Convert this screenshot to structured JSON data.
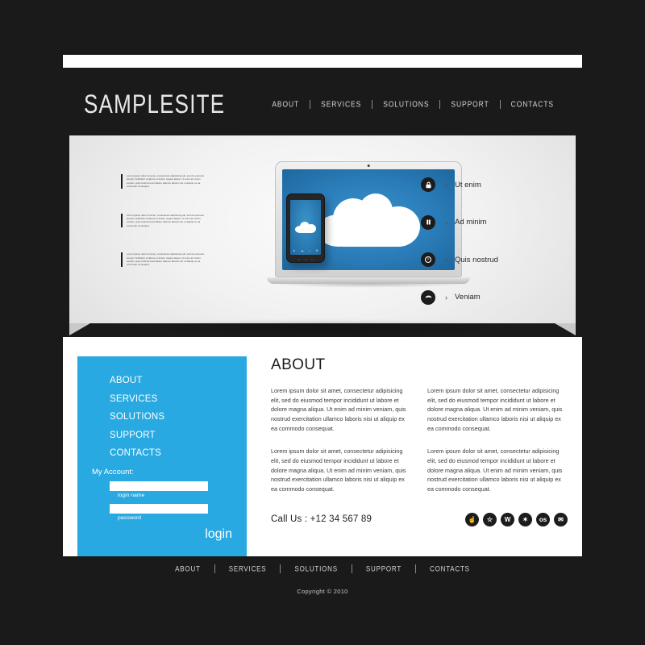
{
  "site": {
    "logo": "SAMPLESITE"
  },
  "topnav": {
    "items": [
      {
        "label": "ABOUT"
      },
      {
        "label": "SERVICES"
      },
      {
        "label": "SOLUTIONS"
      },
      {
        "label": "SUPPORT"
      },
      {
        "label": "CONTACTS"
      }
    ]
  },
  "hero": {
    "blurbs": [
      {
        "text": "Lorem ipsum dolor sit amet, consectetur adipisicing elit, sed do eiusmod tempor incididunt ut labore et dolore magna aliqua. Ut enim ad minim veniam, quis nostrud exercitation ullamco laboris nisi ut aliquip ex ea commodo consequat."
      },
      {
        "text": "Lorem ipsum dolor sit amet, consectetur adipisicing elit, sed do eiusmod tempor incididunt ut labore et dolore magna aliqua. Ut enim ad minim veniam, quis nostrud exercitation ullamco laboris nisi ut aliquip ex ea commodo consequat."
      },
      {
        "text": "Lorem ipsum dolor sit amet, consectetur adipisicing elit, sed do eiusmod tempor incididunt ut labore et dolore magna aliqua. Ut enim ad minim veniam, quis nostrud exercitation ullamco laboris nisi ut aliquip ex ea commodo consequat."
      }
    ],
    "features": [
      {
        "label": "Ut enim",
        "icon": "lock-icon",
        "glyph": " ",
        "arrow": "›"
      },
      {
        "label": "Ad minim",
        "icon": "book-icon",
        "glyph": " ",
        "arrow": "›"
      },
      {
        "label": "Quis nostrud",
        "icon": "clock-icon",
        "glyph": " ",
        "arrow": "›"
      },
      {
        "label": "Veniam",
        "icon": "umbrella-icon",
        "glyph": " ",
        "arrow": "›"
      }
    ],
    "device": {
      "screen_color": "#2a7cb8",
      "cloud_color": "#ffffff",
      "phone_icons": [
        "★",
        "☁",
        "⌕",
        "⚙"
      ],
      "phone_keys": [
        "○",
        "⌂",
        "⌕"
      ]
    }
  },
  "sidebar": {
    "nav": [
      {
        "label": "ABOUT"
      },
      {
        "label": "SERVICES"
      },
      {
        "label": "SOLUTIONS"
      },
      {
        "label": "SUPPORT"
      },
      {
        "label": "CONTACTS"
      }
    ],
    "account_label": "My Account:",
    "login_name": {
      "value": "",
      "placeholder": "",
      "caption": "login name"
    },
    "password": {
      "value": "",
      "placeholder": "",
      "caption": "password"
    },
    "login_button": "login",
    "bg_color": "#29a9e1"
  },
  "main": {
    "title": "ABOUT",
    "paragraphs": [
      "Lorem ipsum dolor sit amet, consectetur adipisicing elit, sed do eiusmod tempor incididunt ut labore et dolore magna aliqua. Ut enim ad minim veniam, quis nostrud exercitation ullamco laboris nisi ut aliquip ex ea commodo consequat.",
      "Lorem ipsum dolor sit amet, consectetur adipisicing elit, sed do eiusmod tempor incididunt ut labore et dolore magna aliqua. Ut enim ad minim veniam, quis nostrud exercitation ullamco laboris nisi ut aliquip ex ea commodo consequat.",
      "Lorem ipsum dolor sit amet, consectetur adipisicing elit, sed do eiusmod tempor incididunt ut labore et dolore magna aliqua. Ut enim ad minim veniam, quis nostrud exercitation ullamco laboris nisi ut aliquip ex ea commodo consequat.",
      "Lorem ipsum dolor sit amet, consectetur adipisicing elit, sed do eiusmod tempor incididunt ut labore et dolore magna aliqua. Ut enim ad minim veniam, quis nostrud exercitation ullamco laboris nisi ut aliquip ex ea commodo consequat."
    ],
    "call_us": "Call Us : +12 34 567 89",
    "socials": [
      {
        "name": "thumbs-up-icon",
        "glyph": "☝"
      },
      {
        "name": "star-icon",
        "glyph": "☆"
      },
      {
        "name": "wordpress-icon",
        "glyph": "W"
      },
      {
        "name": "compass-icon",
        "glyph": "✶"
      },
      {
        "name": "os-icon",
        "glyph": "os"
      },
      {
        "name": "email-icon",
        "glyph": "✉"
      }
    ]
  },
  "footer": {
    "nav": [
      {
        "label": "ABOUT"
      },
      {
        "label": "SERVICES"
      },
      {
        "label": "SOLUTIONS"
      },
      {
        "label": "SUPPORT"
      },
      {
        "label": "CONTACTS"
      }
    ],
    "copyright": "Copyright © 2010"
  },
  "theme": {
    "background": "#1a1a1a",
    "accent": "#29a9e1",
    "dark": "#1c1c1c"
  }
}
